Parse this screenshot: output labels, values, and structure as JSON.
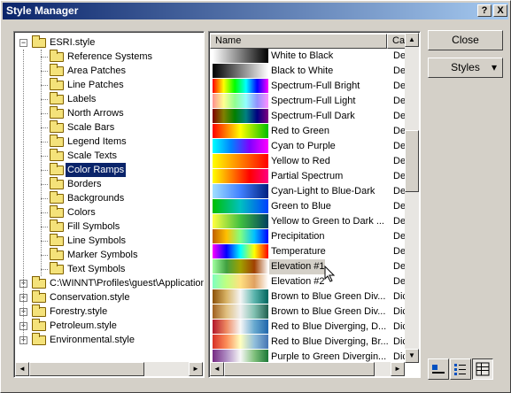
{
  "window": {
    "title": "Style Manager",
    "help_btn": "?",
    "close_btn": "X"
  },
  "tree": {
    "items": [
      {
        "label": "ESRI.style",
        "level": 0,
        "pm": "−",
        "selected": false
      },
      {
        "label": "Reference Systems",
        "level": 1
      },
      {
        "label": "Area Patches",
        "level": 1
      },
      {
        "label": "Line Patches",
        "level": 1
      },
      {
        "label": "Labels",
        "level": 1
      },
      {
        "label": "North Arrows",
        "level": 1
      },
      {
        "label": "Scale Bars",
        "level": 1
      },
      {
        "label": "Legend Items",
        "level": 1
      },
      {
        "label": "Scale Texts",
        "level": 1
      },
      {
        "label": "Color Ramps",
        "level": 1,
        "selected": true
      },
      {
        "label": "Borders",
        "level": 1
      },
      {
        "label": "Backgrounds",
        "level": 1
      },
      {
        "label": "Colors",
        "level": 1
      },
      {
        "label": "Fill Symbols",
        "level": 1
      },
      {
        "label": "Line Symbols",
        "level": 1
      },
      {
        "label": "Marker Symbols",
        "level": 1
      },
      {
        "label": "Text Symbols",
        "level": 1
      },
      {
        "label": "C:\\WINNT\\Profiles\\guest\\Application",
        "level": 0,
        "pm": "+"
      },
      {
        "label": "Conservation.style",
        "level": 0,
        "pm": "+"
      },
      {
        "label": "Forestry.style",
        "level": 0,
        "pm": "+"
      },
      {
        "label": "Petroleum.style",
        "level": 0,
        "pm": "+"
      },
      {
        "label": "Environmental.style",
        "level": 0,
        "pm": "+"
      }
    ]
  },
  "list": {
    "col_name": "Name",
    "col_cat": "Cat",
    "rows": [
      {
        "name": "White to Black",
        "cat": "Def",
        "colors": [
          "#ffffff",
          "#000000"
        ]
      },
      {
        "name": "Black to White",
        "cat": "Def",
        "colors": [
          "#000000",
          "#ffffff"
        ]
      },
      {
        "name": "Spectrum-Full Bright",
        "cat": "Def",
        "colors": [
          "#ff0000",
          "#ffff00",
          "#00ff00",
          "#00ffff",
          "#0000ff",
          "#ff00ff"
        ]
      },
      {
        "name": "Spectrum-Full Light",
        "cat": "Def",
        "colors": [
          "#ff9090",
          "#ffff90",
          "#90ff90",
          "#90ffff",
          "#9090ff",
          "#ff90ff"
        ]
      },
      {
        "name": "Spectrum-Full Dark",
        "cat": "Def",
        "colors": [
          "#800000",
          "#808000",
          "#008000",
          "#008080",
          "#000080",
          "#800080"
        ]
      },
      {
        "name": "Red to Green",
        "cat": "Def",
        "colors": [
          "#ff0000",
          "#ffff00",
          "#00c000"
        ]
      },
      {
        "name": "Cyan to Purple",
        "cat": "Def",
        "colors": [
          "#00ffff",
          "#0080ff",
          "#8000ff",
          "#ff00ff"
        ]
      },
      {
        "name": "Yellow to Red",
        "cat": "Def",
        "colors": [
          "#ffff00",
          "#ff8000",
          "#ff0000"
        ]
      },
      {
        "name": "Partial Spectrum",
        "cat": "Def",
        "colors": [
          "#ffff00",
          "#ff8000",
          "#ff0000",
          "#ff0080"
        ]
      },
      {
        "name": "Cyan-Light to Blue-Dark",
        "cat": "Def",
        "colors": [
          "#a0e0ff",
          "#4080ff",
          "#002080"
        ]
      },
      {
        "name": "Green to Blue",
        "cat": "Def",
        "colors": [
          "#00c000",
          "#00c0c0",
          "#0040ff"
        ]
      },
      {
        "name": "Yellow to Green to Dark ...",
        "cat": "Def",
        "colors": [
          "#ffff40",
          "#40c040",
          "#004060"
        ]
      },
      {
        "name": "Precipitation",
        "cat": "Def",
        "colors": [
          "#c06000",
          "#ffc000",
          "#80ff80",
          "#00c0ff",
          "#0000ff"
        ]
      },
      {
        "name": "Temperature",
        "cat": "Def",
        "colors": [
          "#ff00ff",
          "#0000ff",
          "#00ffff",
          "#ffff00",
          "#ff0000"
        ]
      },
      {
        "name": "Elevation #1",
        "cat": "Def",
        "colors": [
          "#a0ffa0",
          "#40a040",
          "#a0a000",
          "#a04000",
          "#ffffff"
        ],
        "highlight": true
      },
      {
        "name": "Elevation #2",
        "cat": "Def",
        "colors": [
          "#80ffc0",
          "#c0ff80",
          "#ffe080",
          "#e0a060",
          "#ffffff"
        ]
      },
      {
        "name": "Brown to Blue Green Div...",
        "cat": "Dic",
        "colors": [
          "#8c510a",
          "#d8b365",
          "#f5f5f5",
          "#5ab4ac",
          "#01665e"
        ]
      },
      {
        "name": "Brown to Blue Green Div...",
        "cat": "Dic",
        "colors": [
          "#a06020",
          "#e0c080",
          "#f0f0f0",
          "#80c0b0",
          "#206050"
        ]
      },
      {
        "name": "Red to Blue Diverging, D...",
        "cat": "Dic",
        "colors": [
          "#b2182b",
          "#ef8a62",
          "#f7f7f7",
          "#67a9cf",
          "#2166ac"
        ]
      },
      {
        "name": "Red to Blue Diverging, Br...",
        "cat": "Dic",
        "colors": [
          "#d73027",
          "#fc8d59",
          "#ffffbf",
          "#91bfdb",
          "#4575b4"
        ]
      },
      {
        "name": "Purple to Green Divergin...",
        "cat": "Dic",
        "colors": [
          "#762a83",
          "#af8dc3",
          "#f7f7f7",
          "#7fbf7b",
          "#1b7837"
        ]
      }
    ]
  },
  "buttons": {
    "close": "Close",
    "styles": "Styles",
    "styles_arrow": "▾"
  },
  "scroll": {
    "up": "▲",
    "down": "▼",
    "left": "◄",
    "right": "►"
  }
}
